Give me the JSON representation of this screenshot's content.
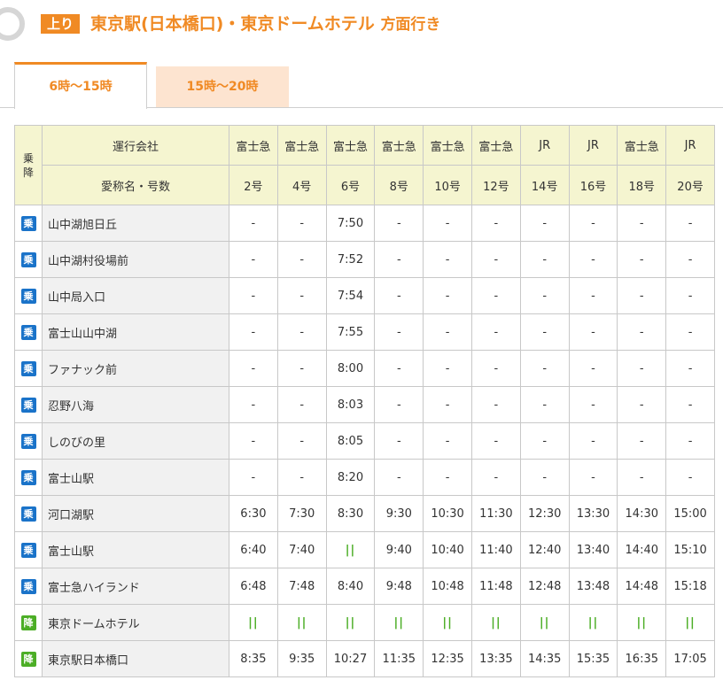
{
  "header": {
    "direction_badge": "上り",
    "title_main": "東京駅(日本橋口)・東京ドームホテル",
    "title_suffix": "方面行き"
  },
  "tabs": [
    {
      "label": "6時〜15時",
      "active": true
    },
    {
      "label": "15時〜20時",
      "active": false
    }
  ],
  "table": {
    "ride_alight_header": [
      "乗",
      "降"
    ],
    "operator_label": "運行会社",
    "name_label": "愛称名・号数",
    "operators": [
      "富士急",
      "富士急",
      "富士急",
      "富士急",
      "富士急",
      "富士急",
      "JR",
      "JR",
      "富士急",
      "JR"
    ],
    "numbers": [
      "2号",
      "4号",
      "6号",
      "8号",
      "10号",
      "12号",
      "14号",
      "16号",
      "18号",
      "20号"
    ],
    "pass_symbol": "||",
    "rows": [
      {
        "mark": "乗",
        "type": "ride",
        "station": "山中湖旭日丘",
        "times": [
          "-",
          "-",
          "7:50",
          "-",
          "-",
          "-",
          "-",
          "-",
          "-",
          "-"
        ]
      },
      {
        "mark": "乗",
        "type": "ride",
        "station": "山中湖村役場前",
        "times": [
          "-",
          "-",
          "7:52",
          "-",
          "-",
          "-",
          "-",
          "-",
          "-",
          "-"
        ]
      },
      {
        "mark": "乗",
        "type": "ride",
        "station": "山中局入口",
        "times": [
          "-",
          "-",
          "7:54",
          "-",
          "-",
          "-",
          "-",
          "-",
          "-",
          "-"
        ]
      },
      {
        "mark": "乗",
        "type": "ride",
        "station": "富士山山中湖",
        "times": [
          "-",
          "-",
          "7:55",
          "-",
          "-",
          "-",
          "-",
          "-",
          "-",
          "-"
        ]
      },
      {
        "mark": "乗",
        "type": "ride",
        "station": "ファナック前",
        "times": [
          "-",
          "-",
          "8:00",
          "-",
          "-",
          "-",
          "-",
          "-",
          "-",
          "-"
        ]
      },
      {
        "mark": "乗",
        "type": "ride",
        "station": "忍野八海",
        "times": [
          "-",
          "-",
          "8:03",
          "-",
          "-",
          "-",
          "-",
          "-",
          "-",
          "-"
        ]
      },
      {
        "mark": "乗",
        "type": "ride",
        "station": "しのびの里",
        "times": [
          "-",
          "-",
          "8:05",
          "-",
          "-",
          "-",
          "-",
          "-",
          "-",
          "-"
        ]
      },
      {
        "mark": "乗",
        "type": "ride",
        "station": "富士山駅",
        "times": [
          "-",
          "-",
          "8:20",
          "-",
          "-",
          "-",
          "-",
          "-",
          "-",
          "-"
        ]
      },
      {
        "mark": "乗",
        "type": "ride",
        "station": "河口湖駅",
        "times": [
          "6:30",
          "7:30",
          "8:30",
          "9:30",
          "10:30",
          "11:30",
          "12:30",
          "13:30",
          "14:30",
          "15:00"
        ]
      },
      {
        "mark": "乗",
        "type": "ride",
        "station": "富士山駅",
        "times": [
          "6:40",
          "7:40",
          "||",
          "9:40",
          "10:40",
          "11:40",
          "12:40",
          "13:40",
          "14:40",
          "15:10"
        ]
      },
      {
        "mark": "乗",
        "type": "ride",
        "station": "富士急ハイランド",
        "times": [
          "6:48",
          "7:48",
          "8:40",
          "9:48",
          "10:48",
          "11:48",
          "12:48",
          "13:48",
          "14:48",
          "15:18"
        ]
      },
      {
        "mark": "降",
        "type": "alight",
        "station": "東京ドームホテル",
        "times": [
          "||",
          "||",
          "||",
          "||",
          "||",
          "||",
          "||",
          "||",
          "||",
          "||"
        ]
      },
      {
        "mark": "降",
        "type": "alight",
        "station": "東京駅日本橋口",
        "times": [
          "8:35",
          "9:35",
          "10:27",
          "11:35",
          "12:35",
          "13:35",
          "14:35",
          "15:35",
          "16:35",
          "17:05"
        ]
      }
    ]
  },
  "colors": {
    "accent": "#f08a24",
    "ride_badge": "#1a73c9",
    "alight_badge": "#4cae26",
    "header_cell_bg": "#f5f5d0",
    "station_bg": "#f1f1f1",
    "inactive_tab_bg": "#fde4d0"
  }
}
